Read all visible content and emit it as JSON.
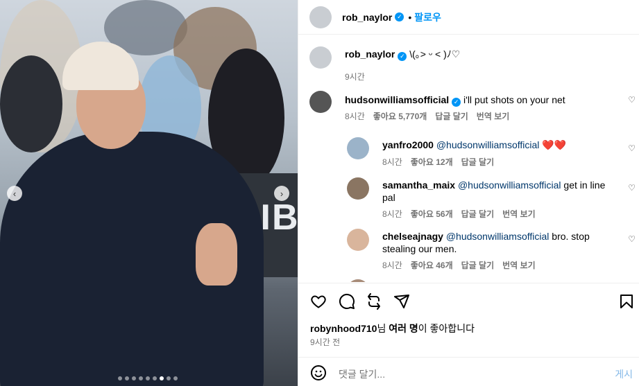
{
  "post": {
    "author": "rob_naylor",
    "follow": "팔로우",
    "sep": "•",
    "caption": "\\(｡> ᵕ < )ﾉ♡",
    "caption_time": "9시간"
  },
  "comments": [
    {
      "user": "hudsonwilliamsofficial",
      "verified": true,
      "text": "i'll put shots on your net",
      "time": "8시간",
      "likes": "좋아요 5,770개",
      "reply": "답글 달기",
      "translate": "번역 보기"
    },
    {
      "user": "yanfro2000",
      "mention": "@hudsonwilliamsofficial",
      "text": "❤️❤️",
      "time": "8시간",
      "likes": "좋아요 12개",
      "reply": "답글 달기"
    },
    {
      "user": "samantha_maix",
      "mention": "@hudsonwilliamsofficial",
      "text_line1": "get in line",
      "text_line2": "pal",
      "time": "8시간",
      "likes": "좋아요 56개",
      "reply": "답글 달기",
      "translate": "번역 보기"
    },
    {
      "user": "chelseajnagy",
      "mention": "@hudsonwilliamsofficial",
      "text_line1": "bro. stop",
      "text_line2": "stealing our men.",
      "time": "8시간",
      "likes": "좋아요 46개",
      "reply": "답글 달기",
      "translate": "번역 보기"
    }
  ],
  "media": {
    "banner_text": "CIBO",
    "carousel_count": 9,
    "carousel_active": 7
  },
  "footer": {
    "liked_by": "robynhood710",
    "liked_suffix1": "님 ",
    "liked_many": "여러 명",
    "liked_suffix2": "이 좋아합니다",
    "time": "9시간 전",
    "comment_placeholder": "댓글 달기...",
    "post_label": "게시"
  },
  "icons": [
    "heart-icon",
    "comment-icon",
    "share-icon",
    "send-icon",
    "bookmark-icon",
    "emoji-icon",
    "chevron-left-icon",
    "chevron-right-icon",
    "verified-icon"
  ],
  "colors": {
    "accent": "#0095f6",
    "muted": "#737373",
    "link": "#00376b"
  }
}
